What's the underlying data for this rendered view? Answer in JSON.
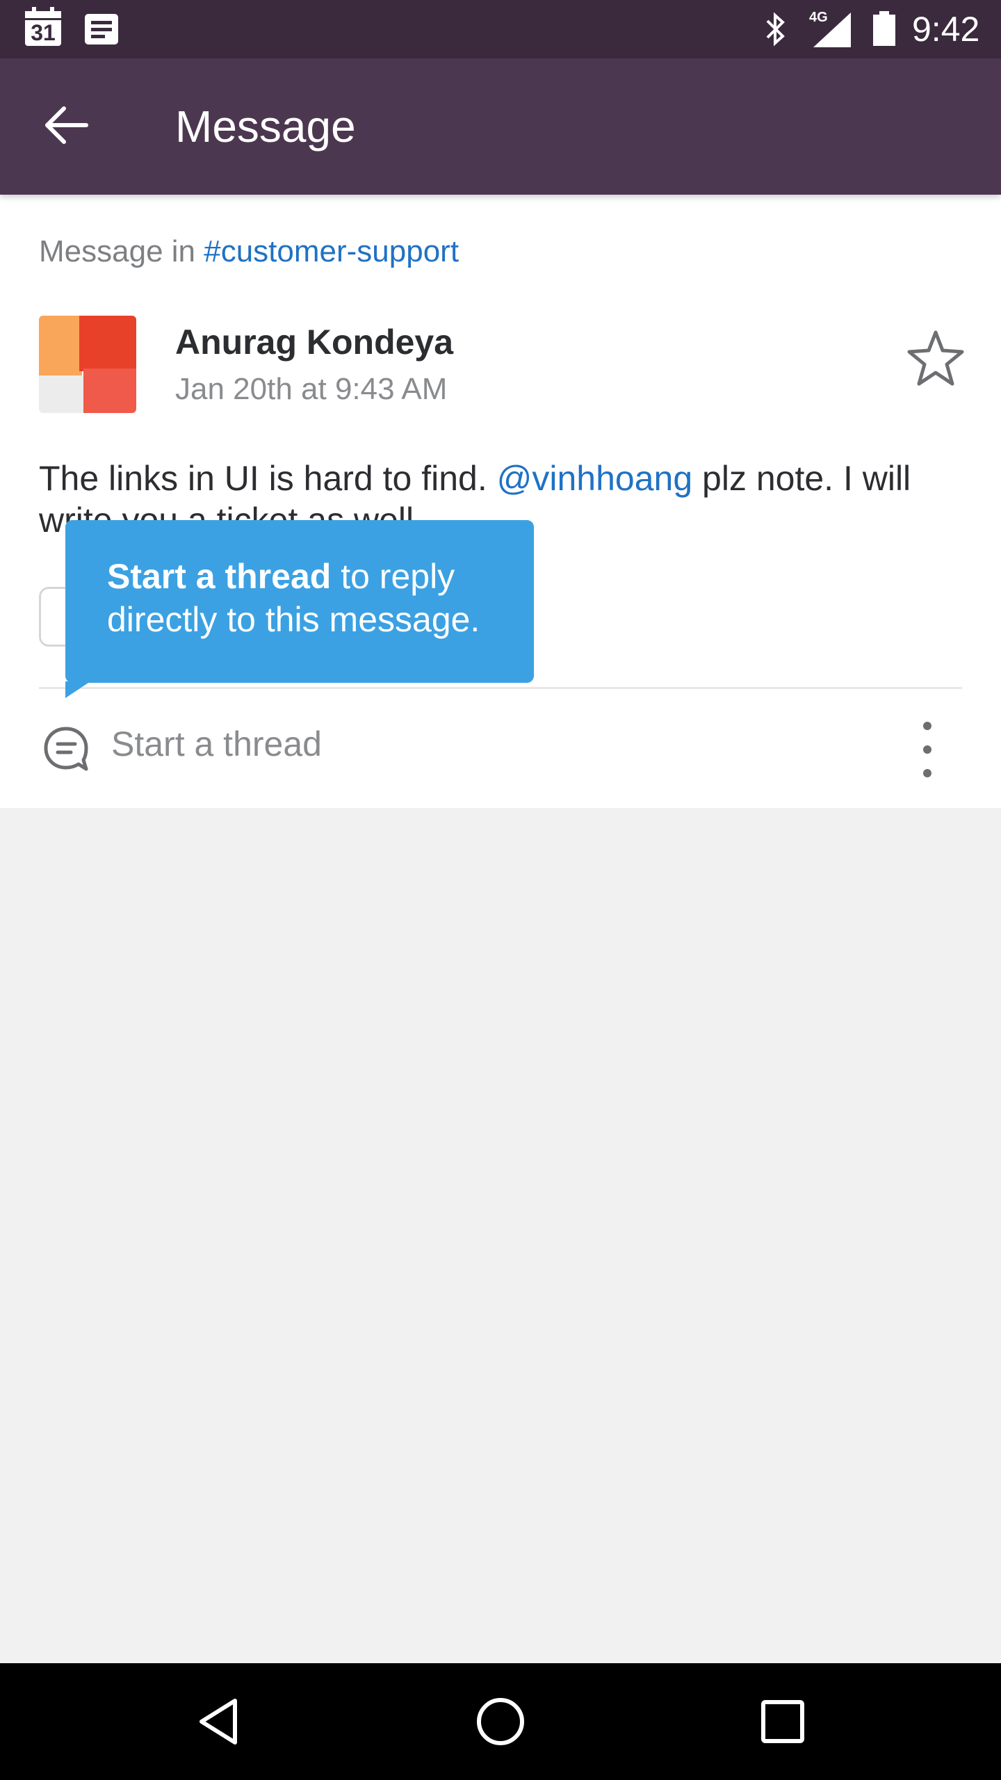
{
  "status_bar": {
    "calendar_date": "31",
    "network": "4G",
    "time": "9:42",
    "icons": [
      "calendar-icon",
      "notes-icon",
      "bluetooth-icon",
      "signal-icon",
      "battery-icon"
    ]
  },
  "app_bar": {
    "title": "Message",
    "back_icon": "arrow-left-icon"
  },
  "message": {
    "context_prefix": "Message in ",
    "channel": "#customer-support",
    "author": "Anurag Kondeya",
    "timestamp": "Jan 20th at 9:43 AM",
    "text_before": "The links in UI is hard to find. ",
    "mention": "@vinhhoang",
    "text_after": " plz note. I will write you a ticket as well."
  },
  "thread": {
    "label": "Start a thread",
    "icon": "thread-bubble-icon",
    "more_icon": "more-vertical-icon"
  },
  "tooltip": {
    "bold": "Start a thread",
    "rest": " to reply directly to this message."
  },
  "colors": {
    "status_bar": "#3b2a3d",
    "app_bar": "#4c3750",
    "link": "#1f72c4",
    "tooltip": "#3ba1e3"
  },
  "nav_bar": {
    "icons": [
      "back-triangle-icon",
      "home-circle-icon",
      "recents-square-icon"
    ]
  }
}
